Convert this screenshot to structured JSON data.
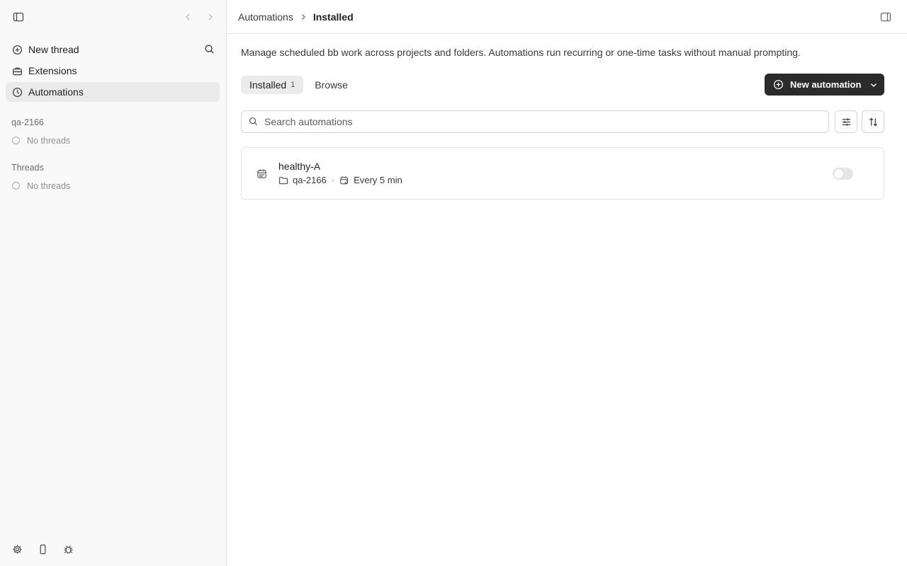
{
  "sidebar": {
    "nav": [
      {
        "label": "New thread",
        "icon": "plus-circle-icon"
      },
      {
        "label": "Extensions",
        "icon": "toolbox-icon"
      },
      {
        "label": "Automations",
        "icon": "clock-icon",
        "active": true
      }
    ],
    "project": {
      "name": "qa-2166",
      "empty": "No threads"
    },
    "threads": {
      "title": "Threads",
      "empty": "No threads"
    }
  },
  "header": {
    "breadcrumb": {
      "parent": "Automations",
      "current": "Installed"
    }
  },
  "main": {
    "description": "Manage scheduled bb work across projects and folders. Automations run recurring or one-time tasks without manual prompting.",
    "tabs": [
      {
        "label": "Installed",
        "count": "1",
        "active": true
      },
      {
        "label": "Browse",
        "count": ""
      }
    ],
    "new_automation_label": "New automation",
    "search": {
      "placeholder": "Search automations",
      "value": ""
    },
    "automations": [
      {
        "name": "healthy-A",
        "project": "qa-2166",
        "schedule": "Every 5 min",
        "enabled": false
      }
    ]
  },
  "colors": {
    "primary_button": "#2b2b2b",
    "sidebar_bg": "#f9f9f9",
    "active_nav_bg": "#ebebeb"
  }
}
